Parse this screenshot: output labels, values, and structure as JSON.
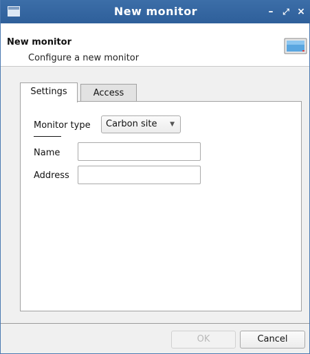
{
  "window": {
    "title": "New monitor",
    "controls": {
      "minimize": "–",
      "maximize": "⤢",
      "close": "×"
    }
  },
  "header": {
    "title": "New monitor",
    "subtitle": "Configure a new monitor",
    "icon": "monitor-icon"
  },
  "tabs": [
    {
      "label": "Settings",
      "active": true
    },
    {
      "label": "Access",
      "active": false
    }
  ],
  "settings": {
    "monitor_type_label": "Monitor type",
    "monitor_type_value": "Carbon site",
    "name_label": "Name",
    "name_value": "",
    "address_label": "Address",
    "address_value": ""
  },
  "buttons": {
    "ok": "OK",
    "ok_enabled": false,
    "cancel": "Cancel"
  },
  "colors": {
    "titlebar": "#3c6ea8",
    "window_bg": "#f0f0f0",
    "disabled_text": "#b8b8b8"
  }
}
